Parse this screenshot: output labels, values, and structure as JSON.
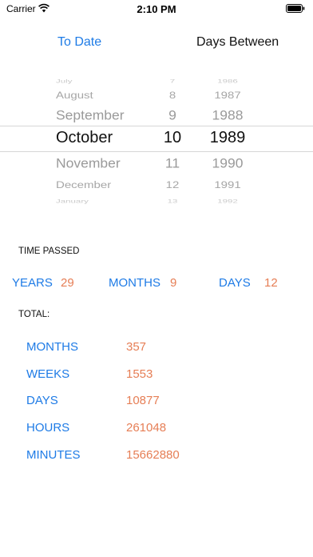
{
  "status": {
    "carrier": "Carrier",
    "time": "2:10 PM"
  },
  "nav": {
    "to_date": "To Date",
    "title": "Days Between"
  },
  "picker": {
    "rows": [
      {
        "month": "July",
        "day": "7",
        "year": "1986",
        "style": "far"
      },
      {
        "month": "August",
        "day": "8",
        "year": "1987",
        "style": "mid"
      },
      {
        "month": "September",
        "day": "9",
        "year": "1988",
        "style": "near"
      },
      {
        "month": "October",
        "day": "10",
        "year": "1989",
        "style": "selected"
      },
      {
        "month": "November",
        "day": "11",
        "year": "1990",
        "style": "near"
      },
      {
        "month": "December",
        "day": "12",
        "year": "1991",
        "style": "mid"
      },
      {
        "month": "January",
        "day": "13",
        "year": "1992",
        "style": "far"
      }
    ]
  },
  "time_passed": {
    "heading": "TIME PASSED",
    "years_label": "YEARS",
    "years_value": "29",
    "months_label": "MONTHS",
    "months_value": "9",
    "days_label": "DAYS",
    "days_value": "12"
  },
  "total": {
    "heading": "TOTAL:",
    "items": [
      {
        "label": "MONTHS",
        "value": "357"
      },
      {
        "label": "WEEKS",
        "value": "1553"
      },
      {
        "label": "DAYS",
        "value": "10877"
      },
      {
        "label": "HOURS",
        "value": "261048"
      },
      {
        "label": "MINUTES",
        "value": "15662880"
      }
    ]
  },
  "colors": {
    "accent": "#1E7BE6",
    "value": "#E67E55"
  }
}
